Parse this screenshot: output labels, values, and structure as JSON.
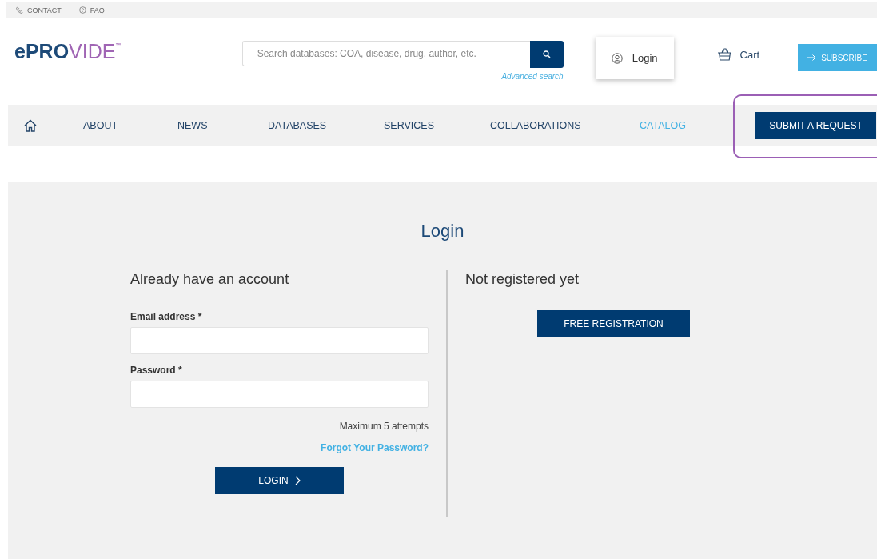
{
  "top_bar": {
    "links": [
      {
        "kind": "phone",
        "label": "CONTACT"
      },
      {
        "kind": "help",
        "label": "FAQ"
      }
    ]
  },
  "logo": {
    "dark": "ePR",
    "o": "O",
    "light": "VIDE",
    "mark": "™"
  },
  "search": {
    "placeholder": "Search databases: COA, disease, drug, author, etc.",
    "advanced": "Advanced search"
  },
  "header_actions": {
    "login": "Login",
    "cart": "Cart",
    "subscribe": "SUBSCRIBE"
  },
  "nav": {
    "items": [
      {
        "label": "ABOUT",
        "selected": false
      },
      {
        "label": "NEWS",
        "selected": false
      },
      {
        "label": "DATABASES",
        "selected": false
      },
      {
        "label": "SERVICES",
        "selected": false
      },
      {
        "label": "COLLABORATIONS",
        "selected": false
      },
      {
        "label": "CATALOG",
        "selected": true
      }
    ],
    "cta": "SUBMIT A REQUEST",
    "highlighted": true
  },
  "login_panel": {
    "title": "Login",
    "left": {
      "heading": "Already have an account",
      "fields": [
        {
          "label": "Email address *"
        },
        {
          "label": "Password *"
        }
      ],
      "note": "Maximum 5 attempts",
      "forgot": "Forgot Your Password?",
      "button": "LOGIN"
    },
    "right": {
      "heading": "Not registered yet",
      "button": "FREE REGISTRATION"
    }
  }
}
